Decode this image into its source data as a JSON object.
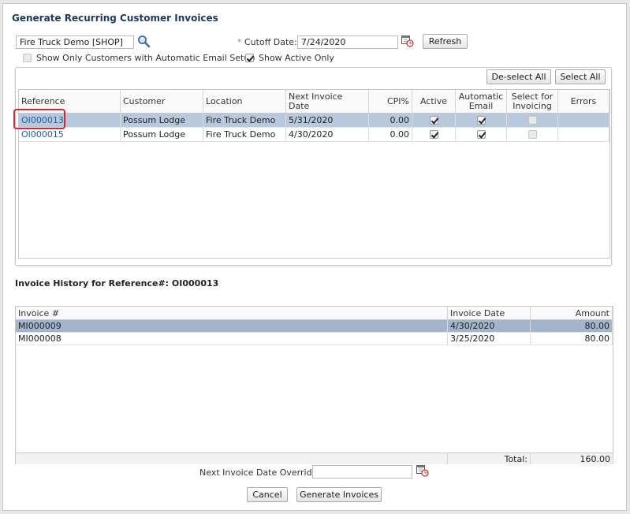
{
  "dialog": {
    "title": "Generate Recurring Customer Invoices"
  },
  "filters": {
    "location_value": "Fire Truck Demo [SHOP]",
    "cutoff_required": "*",
    "cutoff_label": "Cutoff Date:",
    "cutoff_value": "7/24/2020",
    "refresh_label": "Refresh",
    "auto_email_label": "Show Only Customers with Automatic Email Setup",
    "auto_email_checked": false,
    "active_only_label": "Show Active Only",
    "active_only_checked": true
  },
  "recurring_grid": {
    "deselect_all_label": "De-select All",
    "select_all_label": "Select All",
    "headers": {
      "reference": "Reference",
      "customer": "Customer",
      "location": "Location",
      "next_invoice_date": "Next Invoice Date",
      "cpi": "CPI%",
      "active": "Active",
      "auto_email_1": "Automatic",
      "auto_email_2": "Email",
      "select_1": "Select for",
      "select_2": "Invoicing",
      "errors": "Errors"
    },
    "rows": [
      {
        "reference": "OI000013",
        "customer": "Possum Lodge",
        "location": "Fire Truck Demo",
        "next_invoice_date": "5/31/2020",
        "cpi": "0.00",
        "active": true,
        "auto_email": true,
        "selected": false,
        "errors": ""
      },
      {
        "reference": "OI000015",
        "customer": "Possum Lodge",
        "location": "Fire Truck Demo",
        "next_invoice_date": "4/30/2020",
        "cpi": "0.00",
        "active": true,
        "auto_email": true,
        "selected": false,
        "errors": ""
      }
    ]
  },
  "history": {
    "title": "Invoice History for Reference#: OI000013",
    "headers": {
      "invoice": "Invoice #",
      "invoice_date": "Invoice Date",
      "amount": "Amount"
    },
    "rows": [
      {
        "invoice": "MI000009",
        "invoice_date": "4/30/2020",
        "amount": "80.00"
      },
      {
        "invoice": "MI000008",
        "invoice_date": "3/25/2020",
        "amount": "80.00"
      }
    ],
    "total_label": "Total:",
    "total_value": "160.00"
  },
  "override": {
    "label": "Next Invoice Date Override:",
    "value": ""
  },
  "actions": {
    "cancel_label": "Cancel",
    "generate_label": "Generate Invoices"
  },
  "icons": {
    "search": "search-icon",
    "calendar": "calendar-icon"
  },
  "colors": {
    "selected_row": "#b9c9dd",
    "link": "#1f5fa0",
    "highlight": "#d9262a"
  }
}
